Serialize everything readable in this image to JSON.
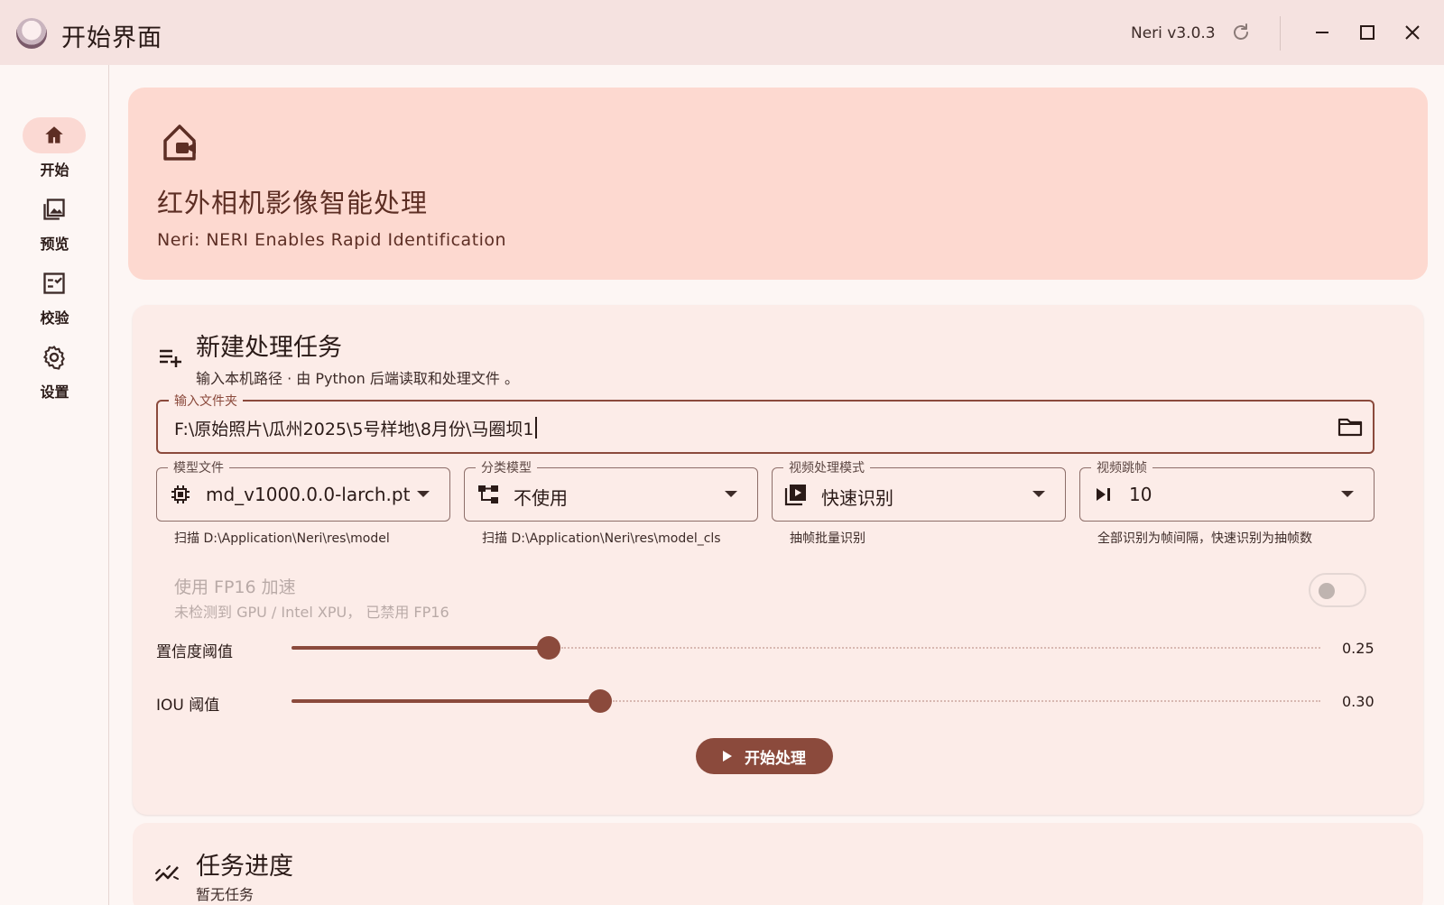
{
  "window": {
    "title": "开始界面",
    "version": "Neri v3.0.3"
  },
  "sidebar": {
    "items": [
      {
        "label": "开始",
        "icon": "home-icon",
        "active": true
      },
      {
        "label": "预览",
        "icon": "gallery-icon",
        "active": false
      },
      {
        "label": "校验",
        "icon": "checklist-icon",
        "active": false
      },
      {
        "label": "设置",
        "icon": "gear-icon",
        "active": false
      }
    ]
  },
  "hero": {
    "title": "红外相机影像智能处理",
    "subtitle": "Neri: NERI Enables Rapid Identification",
    "icon": "home-camera-icon"
  },
  "task": {
    "title": "新建处理任务",
    "subtitle": "输入本机路径 · 由 Python 后端读取和处理文件 。",
    "folder": {
      "label": "输入文件夹",
      "value": "F:\\原始照片\\瓜州2025\\5号样地\\8月份\\马圈坝1",
      "icon": "folder-icon"
    },
    "selects": [
      {
        "label": "模型文件",
        "value": "md_v1000.0.0-larch.pt",
        "helper": "扫描 D:\\Application\\Neri\\res\\model",
        "icon": "chip-icon"
      },
      {
        "label": "分类模型",
        "value": "不使用",
        "helper": "扫描 D:\\Application\\Neri\\res\\model_cls",
        "icon": "tree-icon"
      },
      {
        "label": "视频处理模式",
        "value": "快速识别",
        "helper": "抽帧批量识别",
        "icon": "video-library-icon"
      },
      {
        "label": "视频跳帧",
        "value": "10",
        "helper": "全部识别为帧间隔，快速识别为抽帧数",
        "icon": "skip-next-icon"
      }
    ],
    "fp16": {
      "title": "使用 FP16 加速",
      "subtitle": "未检测到 GPU / Intel XPU， 已禁用 FP16",
      "enabled": false
    },
    "sliders": [
      {
        "label": "置信度阈值",
        "value": "0.25",
        "fraction": 0.25
      },
      {
        "label": "IOU 阈值",
        "value": "0.30",
        "fraction": 0.3
      }
    ],
    "start_label": "开始处理"
  },
  "progress": {
    "title": "任务进度",
    "subtitle": "暂无任务",
    "icon": "trend-icon"
  },
  "colors": {
    "primary": "#8b4a3c",
    "hero_bg": "#fdd9d0",
    "card_bg": "#fcece8",
    "titlebar_bg": "#f5e2e0"
  }
}
